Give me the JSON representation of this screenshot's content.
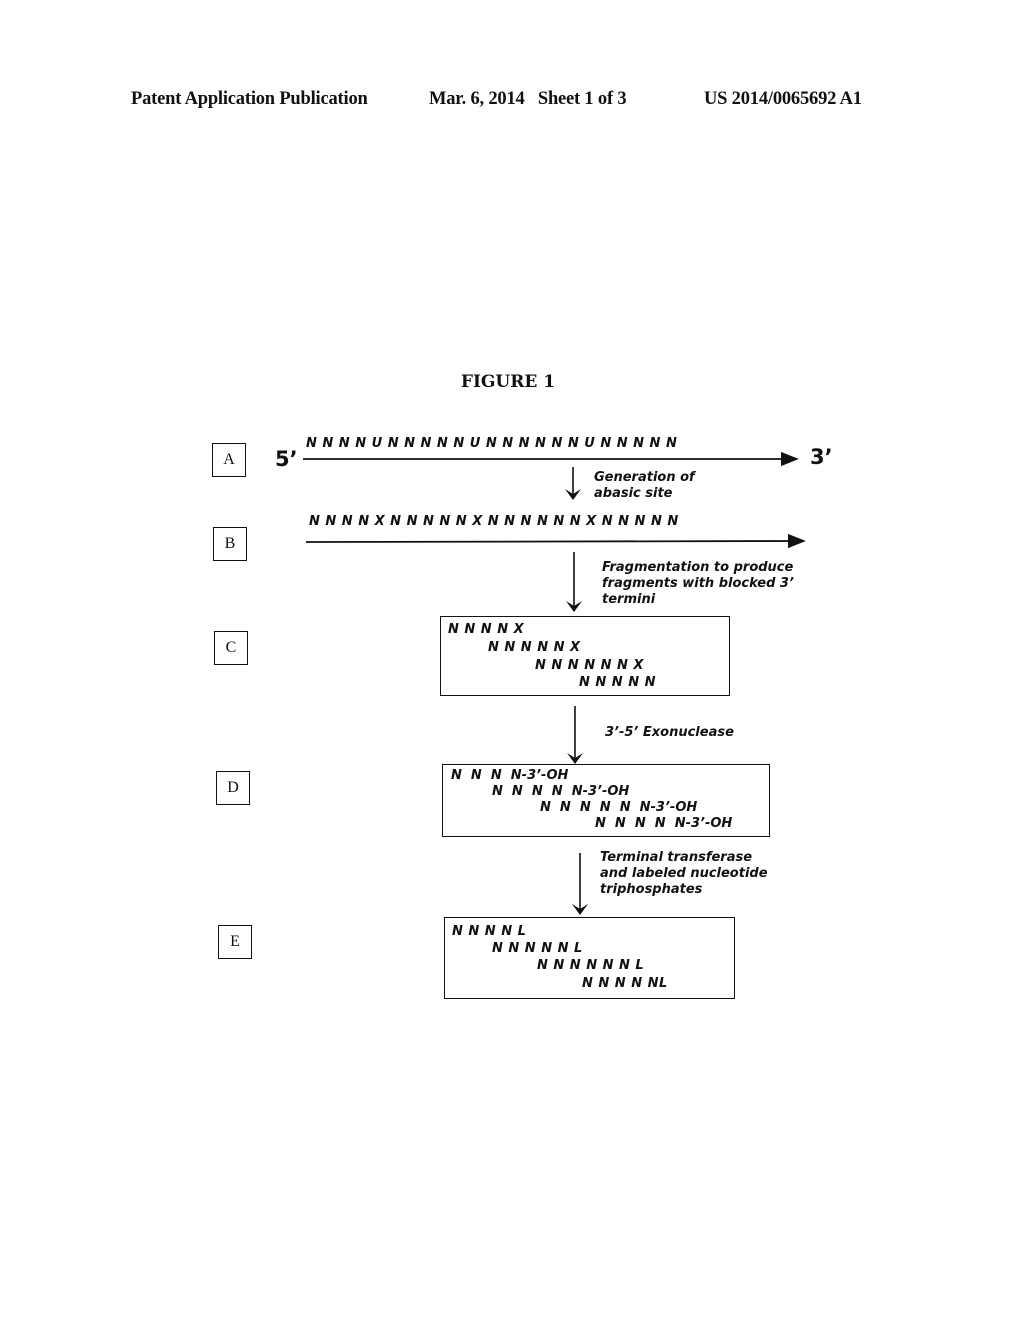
{
  "header": {
    "publication": "Patent Application Publication",
    "date_sheet": "Mar. 6, 2014   Sheet 1 of 3",
    "number": "US 2014/0065692 A1"
  },
  "figure": {
    "title": "FIGURE 1",
    "steps": [
      {
        "label": "A"
      },
      {
        "label": "B"
      },
      {
        "label": "C"
      },
      {
        "label": "D"
      },
      {
        "label": "E"
      }
    ],
    "strand_a": {
      "five_prime": "5’",
      "three_prime": "3’",
      "sequence": "N N N N U N N N N N U N N N N N N U N N N N N"
    },
    "strand_b": {
      "sequence": "N N N N X N N N N N X N N N N N N X N N N N N"
    },
    "transitions": [
      "Generation of\nabasic site",
      "Fragmentation to produce\nfragments with blocked 3’\ntermini",
      "3’-5’ Exonuclease",
      "Terminal transferase\nand labeled nucleotide\ntriphosphates"
    ],
    "fragments_c": [
      "N N N N X",
      "N N N N N X",
      "N N N N N N X",
      "N N N N N"
    ],
    "fragments_d": [
      "N  N  N  N-3’-OH",
      "N  N  N  N  N-3’-OH",
      "N  N  N  N  N  N-3’-OH",
      "N  N  N  N  N-3’-OH"
    ],
    "fragments_e": [
      "N N N N L",
      "N N N N N L",
      "N N N N N N L",
      "N N N N NL"
    ]
  }
}
